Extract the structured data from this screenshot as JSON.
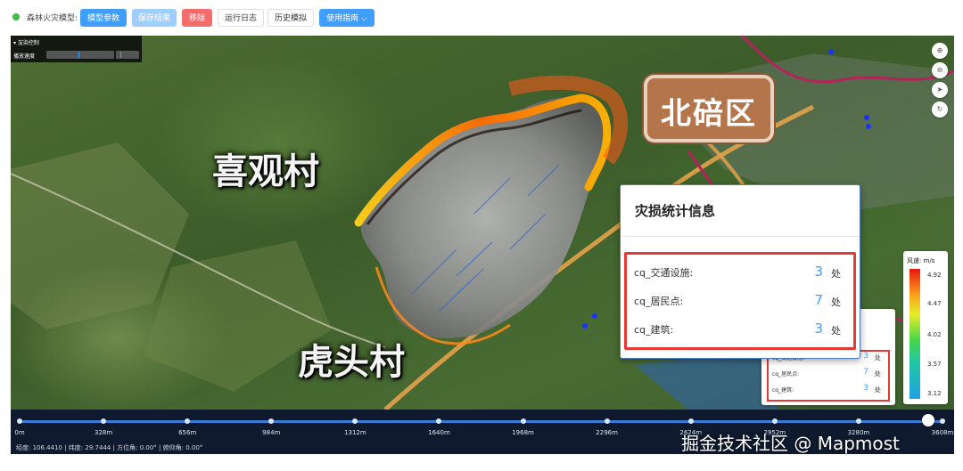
{
  "toolbar": {
    "label": "森林火灾模型:",
    "buttons": [
      {
        "label": "模型参数",
        "state": "primary"
      },
      {
        "label": "保存结果",
        "state": "disabled"
      },
      {
        "label": "移除",
        "state": "danger"
      },
      {
        "label": "运行日志",
        "state": "plain"
      },
      {
        "label": "历史模拟",
        "state": "plain"
      },
      {
        "label": "使用指南",
        "state": "primary"
      }
    ],
    "dropdown_glyph": "⌵"
  },
  "render_control": {
    "title": "▾ 渲染控制",
    "speed_label": "播放速度"
  },
  "map": {
    "places": [
      "喜观村",
      "虎头村",
      "北碚区"
    ],
    "tools": [
      {
        "icon": "zoom-in-icon",
        "glyph": "⊕"
      },
      {
        "icon": "zoom-out-icon",
        "glyph": "⊖"
      },
      {
        "icon": "compass-icon",
        "glyph": "➤"
      },
      {
        "icon": "reset-icon",
        "glyph": "↻"
      }
    ]
  },
  "stats": {
    "title": "灾损统计信息",
    "rows": [
      {
        "name": "cq_交通设施:",
        "value": "3",
        "unit": "处"
      },
      {
        "name": "cq_居民点:",
        "value": "7",
        "unit": "处"
      },
      {
        "name": "cq_建筑:",
        "value": "3",
        "unit": "处"
      }
    ]
  },
  "stats_small": {
    "rows": [
      {
        "name": "cq_交通设施:",
        "value": "3",
        "unit": "处"
      },
      {
        "name": "cq_居民点:",
        "value": "7",
        "unit": "处"
      },
      {
        "name": "cq_建筑:",
        "value": "3",
        "unit": "处"
      }
    ]
  },
  "legend": {
    "title": "风速: m/s",
    "ticks": [
      "4.92",
      "4.47",
      "4.02",
      "3.57",
      "3.12"
    ]
  },
  "timeline": {
    "ticks": [
      "0m",
      "328m",
      "656m",
      "984m",
      "1312m",
      "1640m",
      "1968m",
      "2296m",
      "2624m",
      "2952m",
      "3280m",
      "3608m"
    ],
    "position_fraction": 0.985,
    "info": "经度: 106.4410  |  纬度: 29.7444  |  方位角: 0.00°  |  俯仰角: 0.00°"
  },
  "watermark": "掘金技术社区 @ Mapmost",
  "colors": {
    "primary": "#409eff",
    "danger": "#f56c6c",
    "highlight": "#e53935",
    "status_ok": "#3dbd4a"
  }
}
